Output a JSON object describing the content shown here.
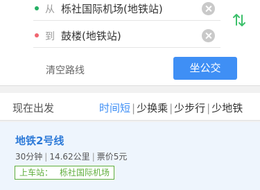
{
  "route": {
    "from_prefix": "从",
    "from_place": "栎社国际机场(地铁站)",
    "to_prefix": "到",
    "to_place": "鼓楼(地铁站)",
    "clear_label": "清空路线",
    "bus_button_label": "坐公交"
  },
  "filter": {
    "depart_label": "现在出发",
    "options": [
      "时间短",
      "少换乘",
      "少步行",
      "少地铁"
    ],
    "active_index": 0
  },
  "result": {
    "line_name": "地铁2号线",
    "duration": "30分钟",
    "distance": "14.62公里",
    "fare": "票价5元",
    "board_label": "上车站：",
    "board_station": "栎社国际机场"
  },
  "colors": {
    "accent_blue": "#3f8ff5",
    "line_blue": "#2d7ad8",
    "green": "#5fae3c",
    "from_dot": "#25b064",
    "to_dot": "#f06570"
  },
  "icons": {
    "swap": "swap-vertical-icon",
    "clear": "clear-circle-icon"
  }
}
